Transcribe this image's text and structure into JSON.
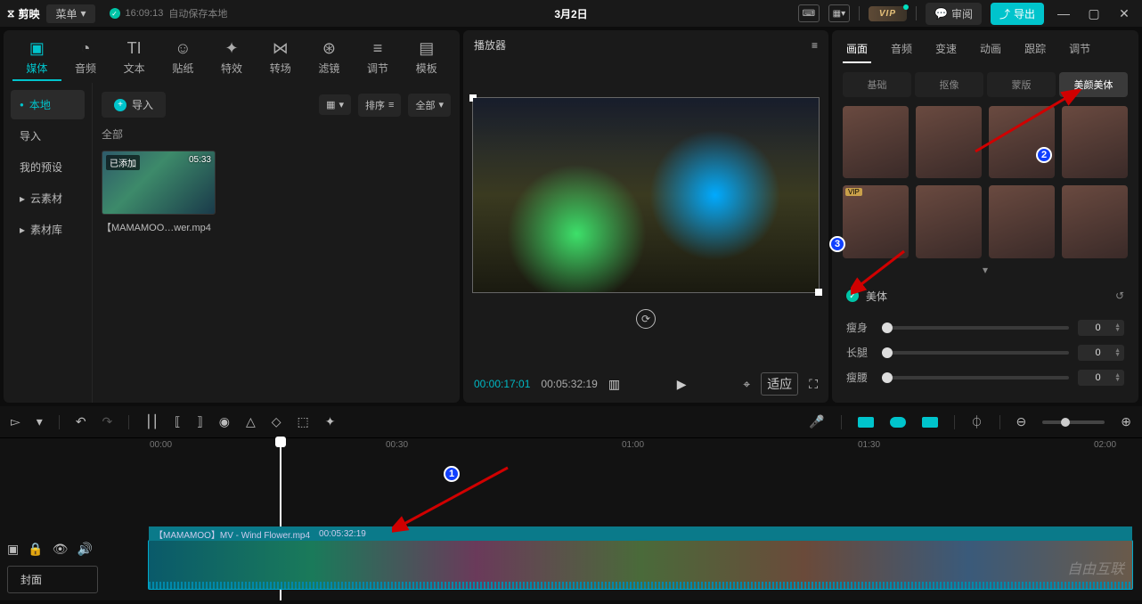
{
  "titlebar": {
    "app": "剪映",
    "menu": "菜单",
    "autosave_time": "16:09:13",
    "autosave_text": "自动保存本地",
    "project": "3月2日",
    "vip": "VIP",
    "review": "审阅",
    "export": "导出"
  },
  "top_tabs": [
    {
      "label": "媒体",
      "active": true
    },
    {
      "label": "音频"
    },
    {
      "label": "文本"
    },
    {
      "label": "贴纸"
    },
    {
      "label": "特效"
    },
    {
      "label": "转场"
    },
    {
      "label": "滤镜"
    },
    {
      "label": "调节"
    },
    {
      "label": "模板"
    }
  ],
  "left_side": [
    {
      "label": "本地",
      "active": true,
      "dot": true
    },
    {
      "label": "导入"
    },
    {
      "label": "我的预设"
    },
    {
      "label": "云素材",
      "chev": true
    },
    {
      "label": "素材库",
      "chev": true
    }
  ],
  "left_content": {
    "import": "导入",
    "sort": "排序",
    "all": "全部",
    "sub": "全部",
    "thumb": {
      "added": "已添加",
      "duration": "05:33",
      "filename": "【MAMAMOO…wer.mp4"
    }
  },
  "player": {
    "title": "播放器",
    "time_current": "00:00:17:01",
    "time_total": "00:05:32:19",
    "fit": "适应"
  },
  "right": {
    "tabs": [
      {
        "label": "画面",
        "active": true
      },
      {
        "label": "音频"
      },
      {
        "label": "变速"
      },
      {
        "label": "动画"
      },
      {
        "label": "跟踪"
      },
      {
        "label": "调节"
      }
    ],
    "subtabs": [
      {
        "label": "基础"
      },
      {
        "label": "抠像"
      },
      {
        "label": "蒙版"
      },
      {
        "label": "美颜美体",
        "active": true
      }
    ],
    "section_label": "美体",
    "sliders": [
      {
        "label": "瘦身",
        "value": "0"
      },
      {
        "label": "长腿",
        "value": "0"
      },
      {
        "label": "瘦腰",
        "value": "0"
      }
    ]
  },
  "timeline": {
    "cover": "封面",
    "ticks": [
      "00:00",
      "00:30",
      "01:00",
      "01:30",
      "02:00"
    ],
    "clip_name": "【MAMAMOO】MV - Wind Flower.mp4",
    "clip_dur": "00:05:32:19"
  },
  "watermark": "自由互联",
  "annotations": {
    "a1": "1",
    "a2": "2",
    "a3": "3"
  }
}
